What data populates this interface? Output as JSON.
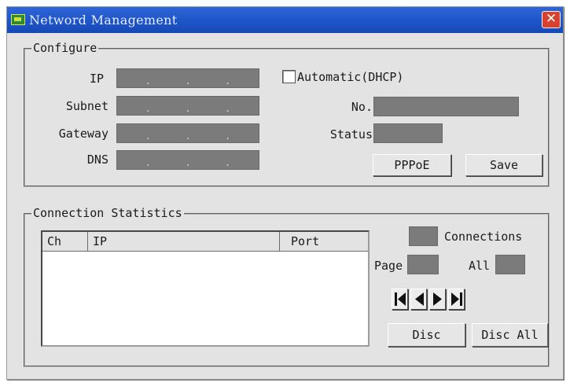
{
  "window": {
    "title": "Netword Management",
    "close_glyph": "✕"
  },
  "configure": {
    "group_label": "Configure",
    "ip_label": "IP",
    "subnet_label": "Subnet",
    "gateway_label": "Gateway",
    "dns_label": "DNS",
    "dot": ".",
    "automatic_label": "Automatic(DHCP)",
    "automatic_checked": false,
    "no_label": "No.",
    "status_label": "Status",
    "pppoe_button": "PPPoE",
    "save_button": "Save"
  },
  "stats": {
    "group_label": "Connection Statistics",
    "columns": [
      "Ch",
      "IP",
      "Port"
    ],
    "rows": [],
    "connections_label": "Connections",
    "page_label": "Page",
    "all_label": "All",
    "nav_icons": [
      "first-page-icon",
      "prev-page-icon",
      "next-page-icon",
      "last-page-icon"
    ],
    "disc_button": "Disc",
    "disc_all_button": "Disc All"
  },
  "colors": {
    "titlebar": "#1e56c9",
    "field": "#7b7b7b",
    "close": "#d8412e",
    "window_bg": "#e3e3e3"
  }
}
